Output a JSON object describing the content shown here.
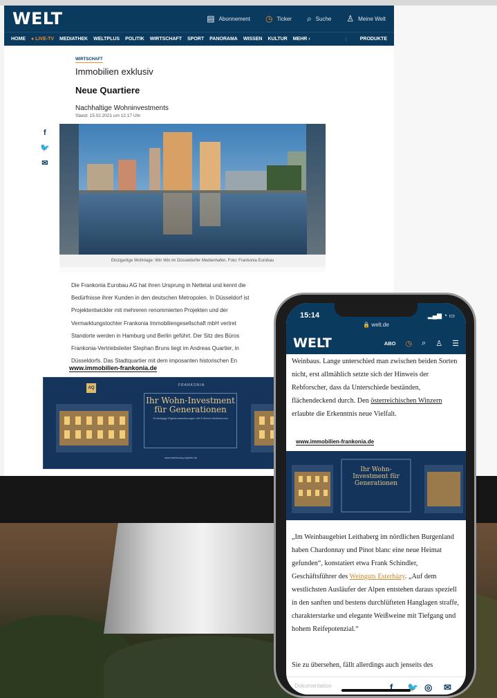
{
  "desktop": {
    "logo": "WELT",
    "utility": [
      {
        "icon": "newspaper-icon",
        "label": "Abonnement"
      },
      {
        "icon": "ticker-icon",
        "label": "Ticker"
      },
      {
        "icon": "search-icon",
        "label": "Suche"
      },
      {
        "icon": "user-icon",
        "label": "Meine Welt"
      }
    ],
    "nav": [
      "HOME",
      "● LIVE-TV",
      "MEDIATHEK",
      "WELTPLUS",
      "POLITIK",
      "WIRTSCHAFT",
      "SPORT",
      "PANORAMA",
      "WISSEN",
      "KULTUR",
      "MEHR ›",
      "PRODUKTE"
    ],
    "article": {
      "kicker": "WIRTSCHAFT",
      "subtitle": "Immobilien exklusiv",
      "headline": "Neue Quartiere",
      "teaser": "Nachhaltige Wohninvestments",
      "date": "Stand: 15.02.2021 um 12:17 Uhr",
      "caption": "Einzigartige Wohnlage: Win Win im Düsseldorfer Medienhafen. Foto: Frankonia Eurobau",
      "body": [
        "Die Frankonia Eurobau AG hat ihren Ursprung in Nettetal und kennt die",
        "Bedürfnisse ihrer Kunden in den deutschen Metropolen. In Düsseldorf ist",
        "Projektentwickler mit mehreren renommierten Projekten und der",
        "Vermarktungstochter Frankonia Immobiliengesellschaft mbH vertret",
        "Standorte werden in Hamburg und Berlin geführt. Der Sitz des Büros",
        "Frankonia-Vertriebsleiter Stephan Bruns liegt im Andreas Quartier, in",
        "Düsseldorfs. Das Stadtquartier mit dem imposanten historischen En"
      ],
      "link": "www.immobilien-frankonia.de"
    },
    "banner": {
      "brand": "FRANKONIA",
      "badge": "AQ",
      "title": "Ihr Wohn-Investment für Generationen",
      "small": "Großzügige Eigentumswohnungen mit 5-Sterne-Wohnservice",
      "url": "www.frankonia-projekte.de"
    }
  },
  "phone": {
    "time": "15:14",
    "host": "🔒 welt.de",
    "logo": "WELT",
    "abo": "ABO",
    "para1": "Weinbaus. Lange unterschied man zwischen beiden Sorten nicht, erst allmählich setzte sich der Hinweis der Rebforscher, dass da Unterschiede beständen, flächendeckend durch. Den ",
    "para1_link": "österreichischen Winzern",
    "para1_end": " erlaubte die Erkenntnis neue Vielfalt.",
    "link": "www.immobilien-frankonia.de",
    "banner_title": "Ihr Wohn-Investment für Generationen",
    "para2": "„Im Weinbaugebiet Leithaberg im nördlichen Burgenland haben Chardonnay und Pinot blanc eine neue Heimat gefunden“, konstatiert etwa Frank Schindler, Geschäftsführer des ",
    "para2_link": "Weinguts Esterházy",
    "para2_end": ". „Auf dem westlichsten Ausläufer der Alpen entstehen daraus speziell in den sanften und bestens durchlüfteten Hanglagen straffe, charakterstarke und elegante Weißweine mit Tiefgang und hohem Reifepotenzial.“",
    "para3": "Sie zu übersehen, fällt allerdings auch jenseits des",
    "bottom_placeholder": "Dokumentation"
  }
}
